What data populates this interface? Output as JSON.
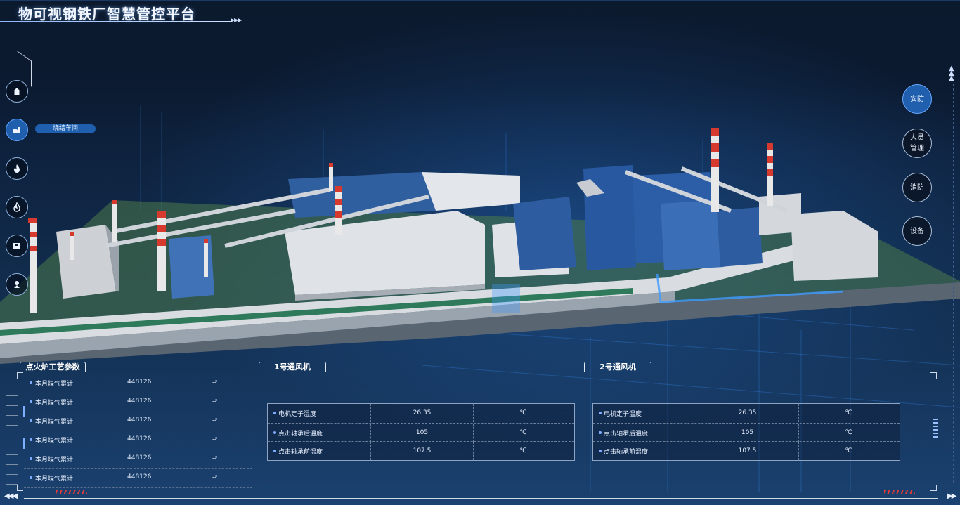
{
  "header": {
    "title": "物可视钢铁厂智慧管控平台"
  },
  "left_nav": {
    "items": [
      {
        "icon": "home-icon"
      },
      {
        "icon": "factory-icon",
        "active": true,
        "tag": "烧结车间"
      },
      {
        "icon": "fire-icon"
      },
      {
        "icon": "flame-icon"
      },
      {
        "icon": "box-icon"
      },
      {
        "icon": "location-icon"
      }
    ]
  },
  "right_nav": {
    "items": [
      {
        "label": "安防",
        "active": true
      },
      {
        "label": "人员\n管理"
      },
      {
        "label": "消防"
      },
      {
        "label": "设备"
      }
    ]
  },
  "process_panel": {
    "title": "点火炉工艺参数",
    "rows": [
      {
        "label": "本月煤气累计",
        "value": "448126",
        "unit": "㎡"
      },
      {
        "label": "本月煤气累计",
        "value": "448126",
        "unit": "㎡"
      },
      {
        "label": "本月煤气累计",
        "value": "448126",
        "unit": "㎡"
      },
      {
        "label": "本月煤气累计",
        "value": "448126",
        "unit": "㎡"
      },
      {
        "label": "本月煤气累计",
        "value": "448126",
        "unit": "㎡"
      },
      {
        "label": "本月煤气累计",
        "value": "448126",
        "unit": "㎡"
      }
    ]
  },
  "fan1": {
    "title": "1号通风机",
    "rows": [
      {
        "label": "电机定子温度",
        "value": "26.35",
        "unit": "℃"
      },
      {
        "label": "点击轴承后温度",
        "value": "105",
        "unit": "℃"
      },
      {
        "label": "点击轴承前温度",
        "value": "107.5",
        "unit": "℃"
      }
    ]
  },
  "fan2": {
    "title": "2号通风机",
    "rows": [
      {
        "label": "电机定子温度",
        "value": "26.35",
        "unit": "℃"
      },
      {
        "label": "点击轴承后温度",
        "value": "105",
        "unit": "℃"
      },
      {
        "label": "点击轴承前温度",
        "value": "107.5",
        "unit": "℃"
      }
    ]
  },
  "colors": {
    "accent": "#1f5fae",
    "glow": "#3f9bff",
    "chimney_red": "#d63a2f"
  }
}
